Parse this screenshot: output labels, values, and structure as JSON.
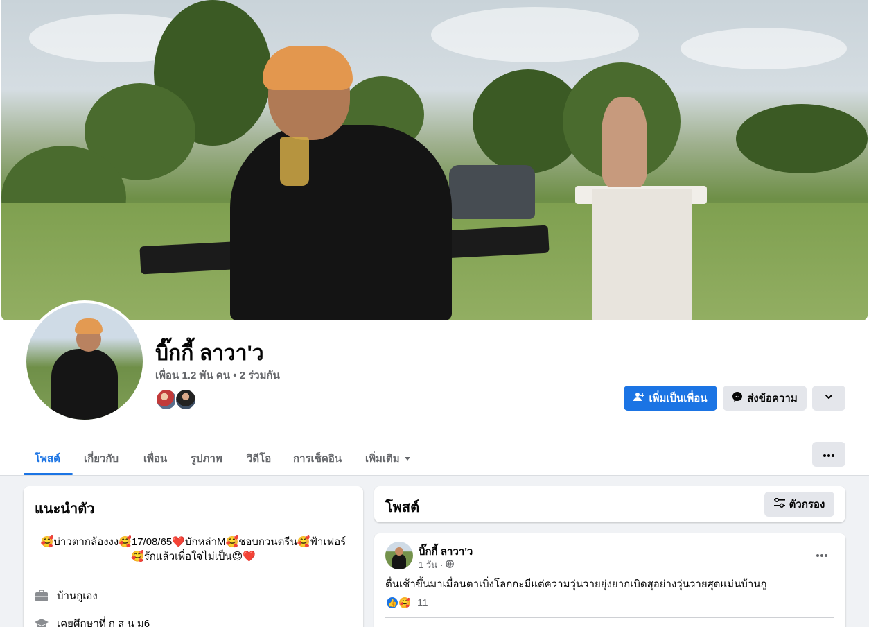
{
  "profile": {
    "name": "บิ๊กกี้ ลาวา'ว",
    "friends_summary": "เพื่อน 1.2 พัน คน • 2 ร่วมกัน",
    "add_friend_label": "เพิ่มเป็นเพื่อน",
    "message_label": "ส่งข้อความ"
  },
  "tabs": [
    {
      "label": "โพสต์",
      "active": true
    },
    {
      "label": "เกี่ยวกับ"
    },
    {
      "label": "เพื่อน"
    },
    {
      "label": "รูปภาพ"
    },
    {
      "label": "วิดีโอ"
    },
    {
      "label": "การเช็คอิน"
    },
    {
      "label": "เพิ่มเติม"
    }
  ],
  "intro": {
    "title": "แนะนำตัว",
    "bio_line1": "🥰บ่าวตากล้องงง🥰17/08/65❤️บักหล่าM🥰ชอบกวนตรีน🥰ฟ้าเฟอร์",
    "bio_line2": "🥰รักแล้วเพื่อใจไม่เป็น😍❤️",
    "work": "บ้านกูเอง",
    "education": "เคยศึกษาที่ ก ส น ม6"
  },
  "posts_section": {
    "title": "โพสต์",
    "filter_label": "ตัวกรอง"
  },
  "post": {
    "author": "บิ๊กกี้ ลาวา'ว",
    "time": "1 วัน",
    "text": "ตื่นเช้าขึ้นมาเมื่อนตาเบิ่งโลกกะมีแต่ความวุ่นวายยุ่งยากเบิดสุอย่างวุ่นวายสุดแม่นบ้านกู",
    "reaction_count": "11"
  },
  "colors": {
    "accent": "#1b74e4",
    "secondary_button": "#e4e6eb",
    "page_background": "#f0f2f5"
  },
  "icons": [
    "add-friend-icon",
    "messenger-icon",
    "chevron-down-icon",
    "more-dots-icon",
    "filter-icon",
    "briefcase-icon",
    "graduation-cap-icon",
    "globe-icon",
    "like-icon",
    "care-icon"
  ]
}
